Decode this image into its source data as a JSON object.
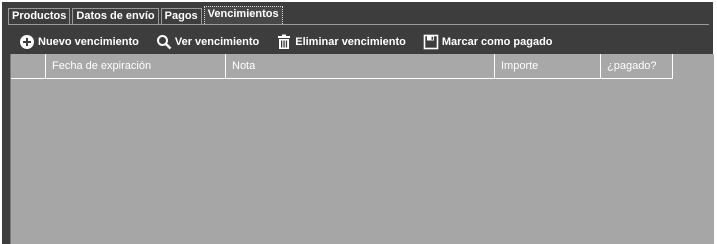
{
  "tabs": [
    {
      "label": "Productos"
    },
    {
      "label": "Datos de envío"
    },
    {
      "label": "Pagos"
    },
    {
      "label": "Vencimientos"
    }
  ],
  "toolbar": {
    "new_label": "Nuevo vencimiento",
    "view_label": "Ver vencimiento",
    "delete_label": "Eliminar vencimiento",
    "mark_paid_label": "Marcar como pagado"
  },
  "table": {
    "columns": [
      "Fecha de expiración",
      "Nota",
      "Importe",
      "¿pagado?"
    ]
  },
  "colors": {
    "panel": "#3d3d3d",
    "grid": "#a6a6a6",
    "text": "#ffffff"
  }
}
